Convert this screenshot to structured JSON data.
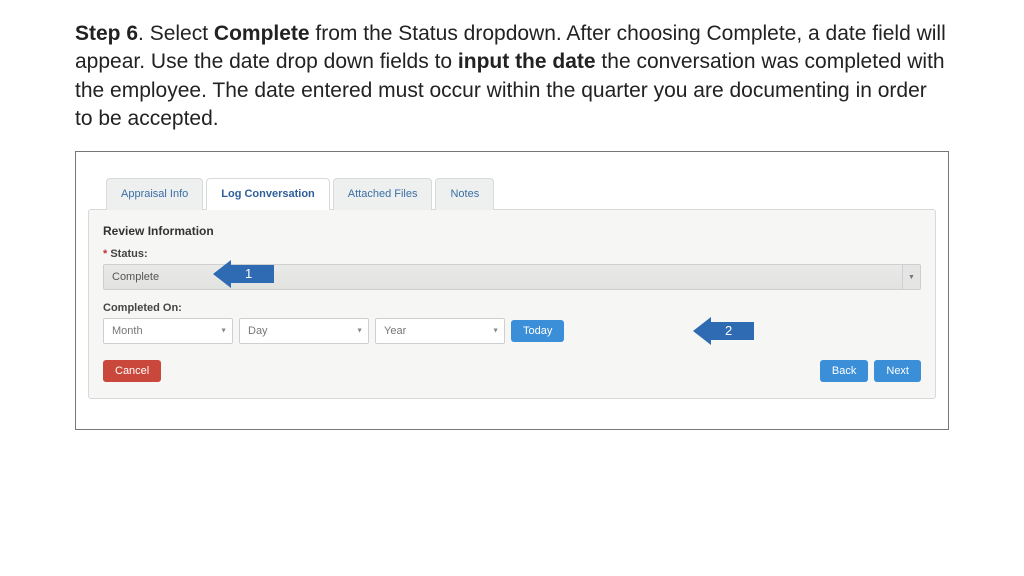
{
  "instructions": {
    "stepLabel": "Step 6",
    "seg1": ".  Select ",
    "bold1": "Complete",
    "seg2": " from the Status dropdown.  After choosing Complete, a date field will appear.  Use the date drop down fields to ",
    "bold2": "input the date",
    "seg3": " the conversation was completed with the employee.  The date entered must occur within the quarter you are documenting in order to be accepted."
  },
  "tabs": {
    "appraisal": "Appraisal Info",
    "log": "Log Conversation",
    "files": "Attached Files",
    "notes": "Notes"
  },
  "panel": {
    "sectionTitle": "Review Information",
    "statusLabel": "Status:",
    "statusValue": "Complete",
    "completedLabel": "Completed On:",
    "month": "Month",
    "day": "Day",
    "year": "Year",
    "today": "Today",
    "cancel": "Cancel",
    "back": "Back",
    "next": "Next"
  },
  "callouts": {
    "one": "1",
    "two": "2"
  }
}
